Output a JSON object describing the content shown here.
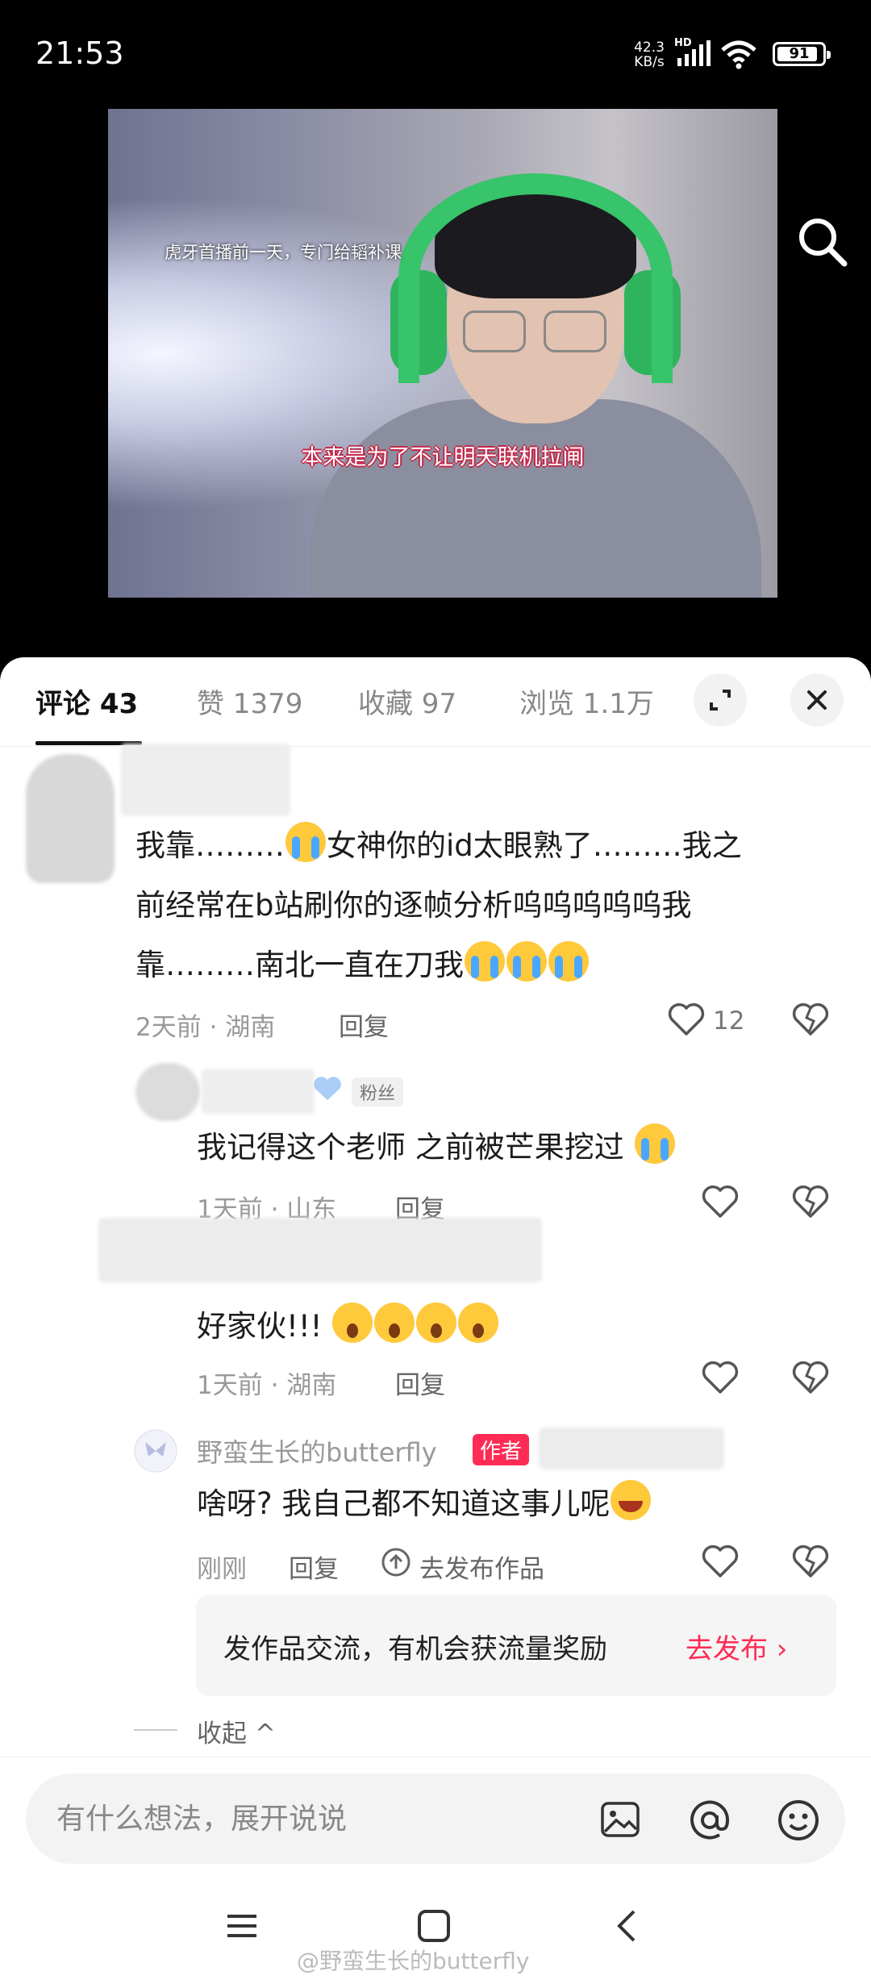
{
  "status_bar": {
    "time": "21:53",
    "speed_value": "42.3",
    "speed_unit": "KB/s",
    "network": "HD",
    "battery": "91"
  },
  "video": {
    "caption_top": "虎牙首播前一天，专门给韬补课",
    "caption_bottom": "本来是为了不让明天联机拉闸"
  },
  "tabs": [
    {
      "label": "评论 43"
    },
    {
      "label": "赞 1379"
    },
    {
      "label": "收藏 97"
    },
    {
      "label": "浏览 1.1万"
    }
  ],
  "comments": [
    {
      "text_parts": [
        "我靠………",
        "女神你的id太眼熟了………我之",
        "前经常在b站刷你的逐帧分析呜呜呜呜呜我",
        "靠………南北一直在刀我"
      ],
      "time": "2天前",
      "location": "湖南",
      "reply": "回复",
      "likes": "12"
    },
    {
      "badge": "粉丝",
      "text": "我记得这个老师  之前被芒果挖过",
      "time": "1天前",
      "location": "山东",
      "reply": "回复"
    },
    {
      "text": "好家伙!!!",
      "time": "1天前",
      "location": "湖南",
      "reply": "回复"
    },
    {
      "author": "野蛮生长的butterfly",
      "badge": "作者",
      "text": "啥呀? 我自己都不知道这事儿呢",
      "time": "刚刚",
      "reply": "回复",
      "publish": "去发布作品"
    }
  ],
  "promo": {
    "text": "发作品交流，有机会获流量奖励",
    "link": "去发布 ›"
  },
  "collapse": "收起 ^",
  "input": {
    "placeholder": "有什么想法，展开说说"
  },
  "watermark": "@野蛮生长的butterfly",
  "colors": {
    "accent": "#fe2c55",
    "headset": "#37c46a"
  }
}
